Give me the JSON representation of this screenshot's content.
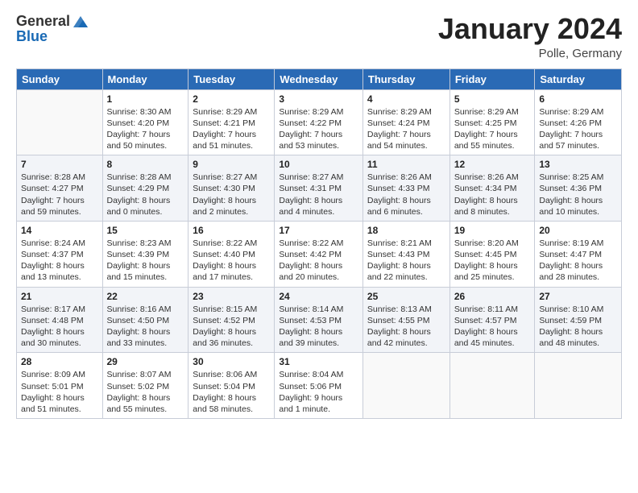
{
  "header": {
    "logo_general": "General",
    "logo_blue": "Blue",
    "month_title": "January 2024",
    "location": "Polle, Germany"
  },
  "calendar": {
    "days_of_week": [
      "Sunday",
      "Monday",
      "Tuesday",
      "Wednesday",
      "Thursday",
      "Friday",
      "Saturday"
    ],
    "weeks": [
      [
        {
          "day": "",
          "info": ""
        },
        {
          "day": "1",
          "info": "Sunrise: 8:30 AM\nSunset: 4:20 PM\nDaylight: 7 hours\nand 50 minutes."
        },
        {
          "day": "2",
          "info": "Sunrise: 8:29 AM\nSunset: 4:21 PM\nDaylight: 7 hours\nand 51 minutes."
        },
        {
          "day": "3",
          "info": "Sunrise: 8:29 AM\nSunset: 4:22 PM\nDaylight: 7 hours\nand 53 minutes."
        },
        {
          "day": "4",
          "info": "Sunrise: 8:29 AM\nSunset: 4:24 PM\nDaylight: 7 hours\nand 54 minutes."
        },
        {
          "day": "5",
          "info": "Sunrise: 8:29 AM\nSunset: 4:25 PM\nDaylight: 7 hours\nand 55 minutes."
        },
        {
          "day": "6",
          "info": "Sunrise: 8:29 AM\nSunset: 4:26 PM\nDaylight: 7 hours\nand 57 minutes."
        }
      ],
      [
        {
          "day": "7",
          "info": "Sunrise: 8:28 AM\nSunset: 4:27 PM\nDaylight: 7 hours\nand 59 minutes."
        },
        {
          "day": "8",
          "info": "Sunrise: 8:28 AM\nSunset: 4:29 PM\nDaylight: 8 hours\nand 0 minutes."
        },
        {
          "day": "9",
          "info": "Sunrise: 8:27 AM\nSunset: 4:30 PM\nDaylight: 8 hours\nand 2 minutes."
        },
        {
          "day": "10",
          "info": "Sunrise: 8:27 AM\nSunset: 4:31 PM\nDaylight: 8 hours\nand 4 minutes."
        },
        {
          "day": "11",
          "info": "Sunrise: 8:26 AM\nSunset: 4:33 PM\nDaylight: 8 hours\nand 6 minutes."
        },
        {
          "day": "12",
          "info": "Sunrise: 8:26 AM\nSunset: 4:34 PM\nDaylight: 8 hours\nand 8 minutes."
        },
        {
          "day": "13",
          "info": "Sunrise: 8:25 AM\nSunset: 4:36 PM\nDaylight: 8 hours\nand 10 minutes."
        }
      ],
      [
        {
          "day": "14",
          "info": "Sunrise: 8:24 AM\nSunset: 4:37 PM\nDaylight: 8 hours\nand 13 minutes."
        },
        {
          "day": "15",
          "info": "Sunrise: 8:23 AM\nSunset: 4:39 PM\nDaylight: 8 hours\nand 15 minutes."
        },
        {
          "day": "16",
          "info": "Sunrise: 8:22 AM\nSunset: 4:40 PM\nDaylight: 8 hours\nand 17 minutes."
        },
        {
          "day": "17",
          "info": "Sunrise: 8:22 AM\nSunset: 4:42 PM\nDaylight: 8 hours\nand 20 minutes."
        },
        {
          "day": "18",
          "info": "Sunrise: 8:21 AM\nSunset: 4:43 PM\nDaylight: 8 hours\nand 22 minutes."
        },
        {
          "day": "19",
          "info": "Sunrise: 8:20 AM\nSunset: 4:45 PM\nDaylight: 8 hours\nand 25 minutes."
        },
        {
          "day": "20",
          "info": "Sunrise: 8:19 AM\nSunset: 4:47 PM\nDaylight: 8 hours\nand 28 minutes."
        }
      ],
      [
        {
          "day": "21",
          "info": "Sunrise: 8:17 AM\nSunset: 4:48 PM\nDaylight: 8 hours\nand 30 minutes."
        },
        {
          "day": "22",
          "info": "Sunrise: 8:16 AM\nSunset: 4:50 PM\nDaylight: 8 hours\nand 33 minutes."
        },
        {
          "day": "23",
          "info": "Sunrise: 8:15 AM\nSunset: 4:52 PM\nDaylight: 8 hours\nand 36 minutes."
        },
        {
          "day": "24",
          "info": "Sunrise: 8:14 AM\nSunset: 4:53 PM\nDaylight: 8 hours\nand 39 minutes."
        },
        {
          "day": "25",
          "info": "Sunrise: 8:13 AM\nSunset: 4:55 PM\nDaylight: 8 hours\nand 42 minutes."
        },
        {
          "day": "26",
          "info": "Sunrise: 8:11 AM\nSunset: 4:57 PM\nDaylight: 8 hours\nand 45 minutes."
        },
        {
          "day": "27",
          "info": "Sunrise: 8:10 AM\nSunset: 4:59 PM\nDaylight: 8 hours\nand 48 minutes."
        }
      ],
      [
        {
          "day": "28",
          "info": "Sunrise: 8:09 AM\nSunset: 5:01 PM\nDaylight: 8 hours\nand 51 minutes."
        },
        {
          "day": "29",
          "info": "Sunrise: 8:07 AM\nSunset: 5:02 PM\nDaylight: 8 hours\nand 55 minutes."
        },
        {
          "day": "30",
          "info": "Sunrise: 8:06 AM\nSunset: 5:04 PM\nDaylight: 8 hours\nand 58 minutes."
        },
        {
          "day": "31",
          "info": "Sunrise: 8:04 AM\nSunset: 5:06 PM\nDaylight: 9 hours\nand 1 minute."
        },
        {
          "day": "",
          "info": ""
        },
        {
          "day": "",
          "info": ""
        },
        {
          "day": "",
          "info": ""
        }
      ]
    ]
  }
}
